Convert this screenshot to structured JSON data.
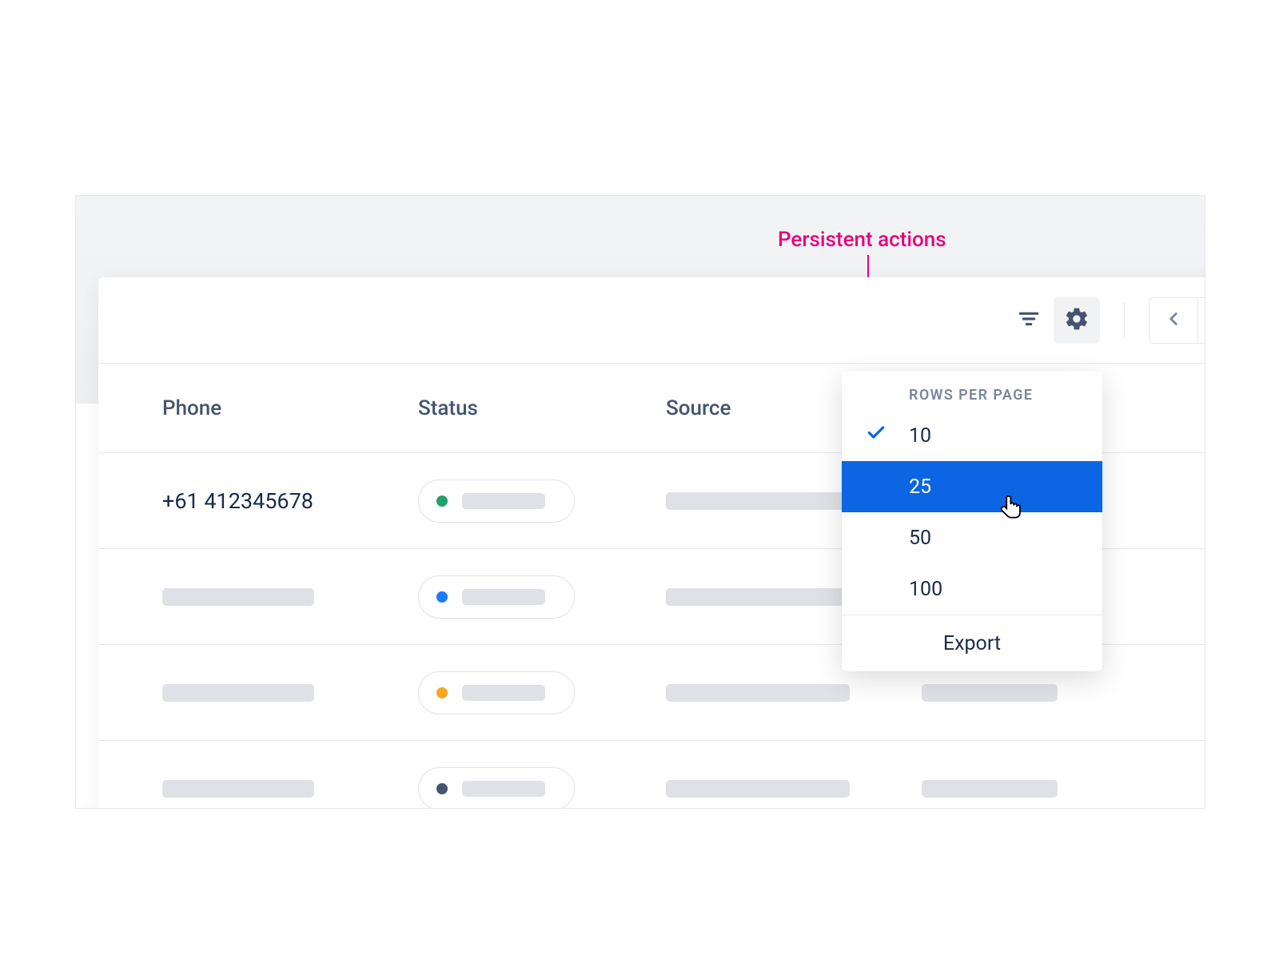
{
  "annotation": {
    "label": "Persistent actions",
    "color": "#e6007e"
  },
  "toolbar": {
    "filter_icon": "filter-icon",
    "settings_icon": "gear-icon",
    "prev_icon": "chevron-left-icon",
    "next_icon": "chevron-right-icon"
  },
  "columns": {
    "phone": "Phone",
    "status": "Status",
    "source": "Source"
  },
  "rows": [
    {
      "phone": "+61 412345678",
      "status_color": "#22a06b"
    },
    {
      "phone": "",
      "status_color": "#1d7afc"
    },
    {
      "phone": "",
      "status_color": "#f5a623"
    },
    {
      "phone": "",
      "status_color": "#44546f"
    }
  ],
  "menu": {
    "header": "ROWS PER PAGE",
    "options": [
      {
        "label": "10",
        "selected": true,
        "hovered": false
      },
      {
        "label": "25",
        "selected": false,
        "hovered": true
      },
      {
        "label": "50",
        "selected": false,
        "hovered": false
      },
      {
        "label": "100",
        "selected": false,
        "hovered": false
      }
    ],
    "export": "Export"
  },
  "colors": {
    "accent": "#0c66e4",
    "annotation": "#e6007e",
    "text": "#172b4d",
    "muted": "#44546f",
    "placeholder": "#dfe1e6"
  }
}
